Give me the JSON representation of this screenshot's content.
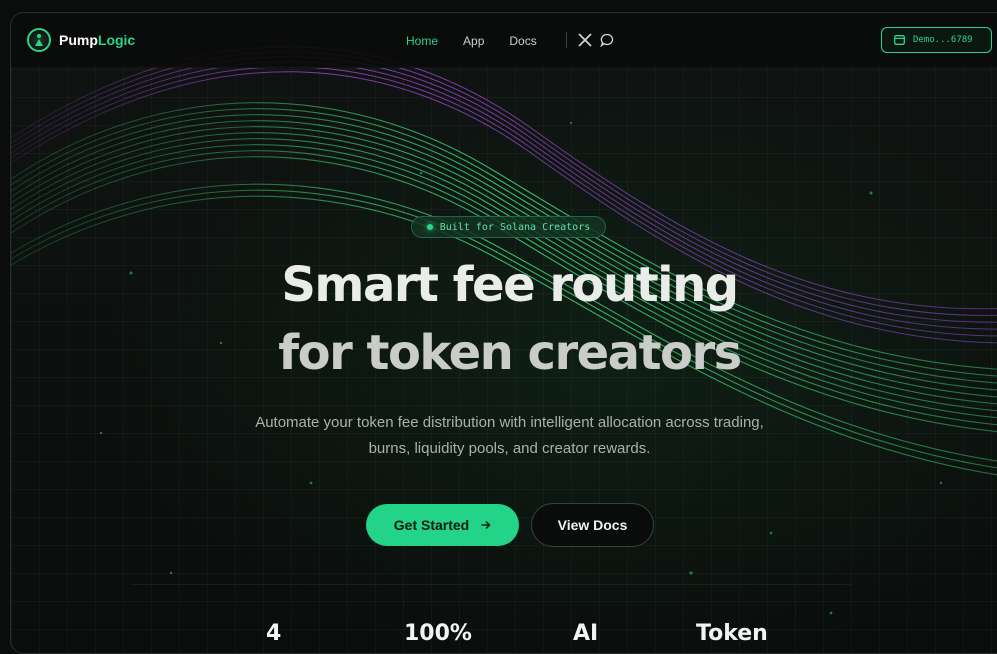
{
  "nav": {
    "brand": {
      "name_part1": "Pump",
      "name_part2": "Logic"
    },
    "links": [
      {
        "label": "Home",
        "active": true
      },
      {
        "label": "App",
        "active": false
      },
      {
        "label": "Docs",
        "active": false
      }
    ],
    "social": [
      "x-icon",
      "chat-icon"
    ],
    "wallet": {
      "label": "Demo...6789",
      "icon": "wallet-icon"
    }
  },
  "hero": {
    "badge": "Built for Solana Creators",
    "title_line1": "Smart fee routing",
    "title_line2": "for token creators",
    "subtitle": "Automate your token fee distribution with intelligent allocation across trading, burns, liquidity pools, and creator rewards.",
    "primary_button": "Get Started",
    "primary_button_icon": "arrow-right-icon",
    "secondary_button": "View Docs"
  },
  "stats": [
    {
      "value": "4"
    },
    {
      "value": "100%"
    },
    {
      "value": "AI"
    },
    {
      "value": "Token"
    }
  ],
  "colors": {
    "accent": "#2bd48a",
    "button": "#22d388",
    "background": "#0c100e",
    "wave_green": "#2fae5c",
    "wave_purple": "#8a3fb4"
  }
}
